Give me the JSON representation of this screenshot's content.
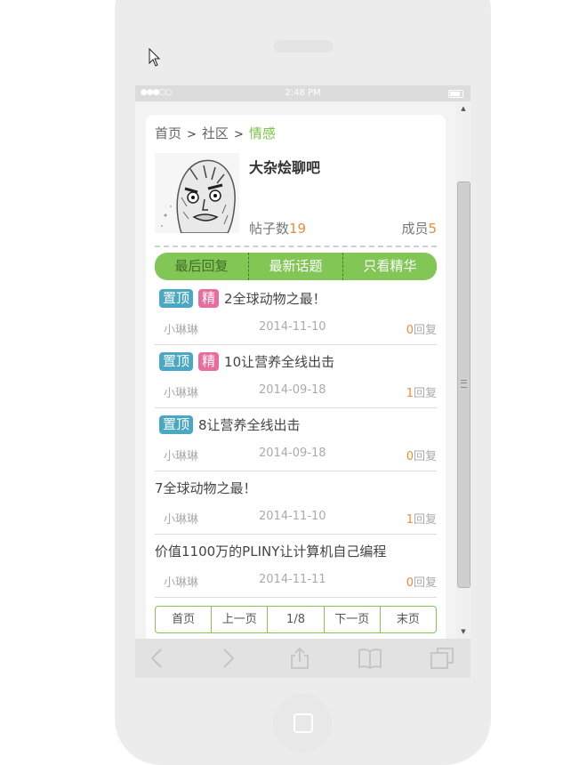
{
  "status_bar": {
    "signal": "●●●○○",
    "time": "2:48 PM"
  },
  "breadcrumb": {
    "home": "首页",
    "community": "社区",
    "current": "情感",
    "separator": ">"
  },
  "group": {
    "name": "大杂烩聊吧",
    "post_count_label": "帖子数",
    "post_count": "19",
    "member_label": "成员",
    "member_count": "5"
  },
  "tabs": [
    {
      "label": "最后回复"
    },
    {
      "label": "最新话题"
    },
    {
      "label": "只看精华"
    }
  ],
  "posts": [
    {
      "pinned": "置顶",
      "essence": "精",
      "title": "2全球动物之最！",
      "author": "小琳琳",
      "date": "2014-11-10",
      "reply_count": "0",
      "reply_label": "回复"
    },
    {
      "pinned": "置顶",
      "essence": "精",
      "title": "10让营养全线出击",
      "author": "小琳琳",
      "date": "2014-09-18",
      "reply_count": "1",
      "reply_label": "回复"
    },
    {
      "pinned": "置顶",
      "title": "8让营养全线出击",
      "author": "小琳琳",
      "date": "2014-09-18",
      "reply_count": "0",
      "reply_label": "回复"
    },
    {
      "title": "7全球动物之最！",
      "author": "小琳琳",
      "date": "2014-11-10",
      "reply_count": "1",
      "reply_label": "回复"
    },
    {
      "title": "价值1100万的PLINY让计算机自己编程",
      "author": "小琳琳",
      "date": "2014-11-11",
      "reply_count": "0",
      "reply_label": "回复"
    }
  ],
  "pager": {
    "first": "首页",
    "prev": "上一页",
    "current": "1/8",
    "next": "下一页",
    "last": "末页"
  },
  "toolbar": {
    "icons": [
      "back-icon",
      "forward-icon",
      "share-icon",
      "bookmarks-icon",
      "tabs-icon"
    ]
  },
  "colors": {
    "accent_green": "#82c655",
    "pinned_badge": "#4aa8c4",
    "essence_badge": "#e86c9d",
    "count_orange": "#f08b3a"
  }
}
